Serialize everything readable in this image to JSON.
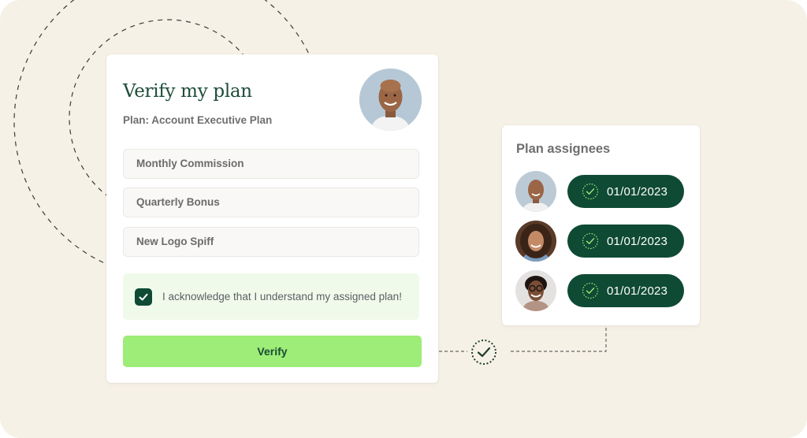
{
  "verify_card": {
    "title": "Verify my plan",
    "subtitle": "Plan: Account Executive Plan",
    "avatar": "user-avatar-man",
    "fields": [
      {
        "label": "Monthly Commission"
      },
      {
        "label": "Quarterly Bonus"
      },
      {
        "label": "New Logo Spiff"
      }
    ],
    "acknowledgement": {
      "checked": true,
      "label": "I acknowledge that I understand my assigned plan!"
    },
    "verify_button_label": "Verify"
  },
  "assignees_card": {
    "title": "Plan assignees",
    "assignees": [
      {
        "avatar": "avatar-man-bald",
        "date": "01/01/2023",
        "status_icon": "check-circle-icon"
      },
      {
        "avatar": "avatar-woman-curly-hair",
        "date": "01/01/2023",
        "status_icon": "check-circle-icon"
      },
      {
        "avatar": "avatar-woman-glasses",
        "date": "01/01/2023",
        "status_icon": "check-circle-icon"
      }
    ]
  },
  "connector": {
    "status_icon": "check-circle-icon"
  },
  "colors": {
    "background": "#f6f1e6",
    "brand_dark_green": "#0f4a34",
    "button_green": "#9ded78",
    "acknowledge_bg": "#f0faea"
  }
}
